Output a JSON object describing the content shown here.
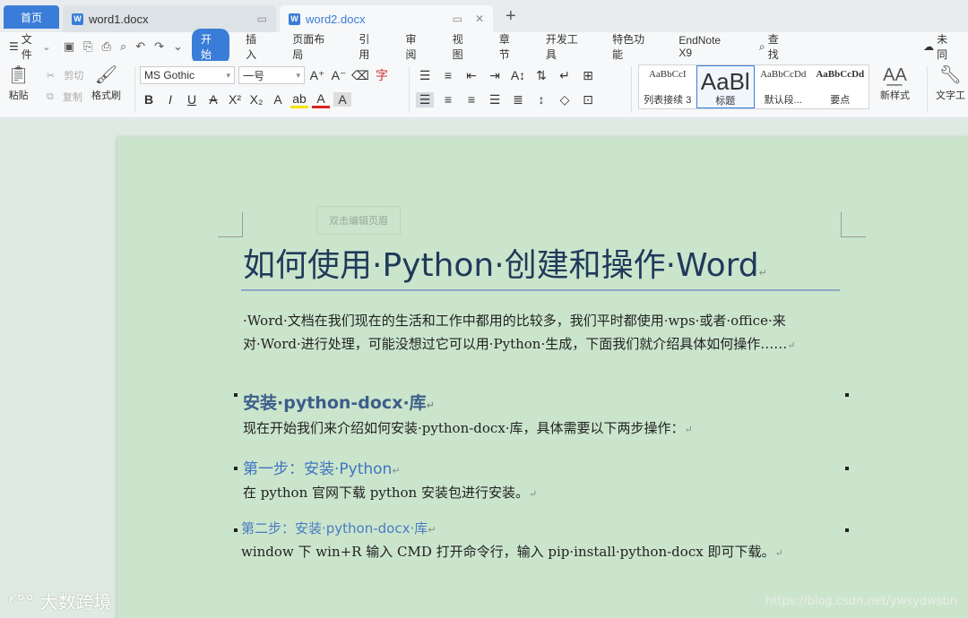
{
  "tabs": {
    "home": "首页",
    "doc1": "word1.docx",
    "doc2": "word2.docx",
    "new_tab": "+"
  },
  "menu": {
    "file": "文件",
    "items": [
      "开始",
      "插入",
      "页面布局",
      "引用",
      "审阅",
      "视图",
      "章节",
      "开发工具",
      "特色功能",
      "EndNote X9"
    ],
    "search": "查找",
    "sync": "未同"
  },
  "ribbon": {
    "paste": "粘贴",
    "cut": "剪切",
    "copy": "复制",
    "format_painter": "格式刷",
    "font_name": "MS Gothic",
    "font_size": "一号",
    "styles": [
      {
        "sample": "AaBbCcI",
        "label": "列表接续 3"
      },
      {
        "sample": "AaBl",
        "label": "标题"
      },
      {
        "sample": "AaBbCcDd",
        "label": "默认段..."
      },
      {
        "sample": "AaBbCcDd",
        "label": "要点"
      }
    ],
    "new_style": "新样式",
    "text_tool": "文字工"
  },
  "document": {
    "header_hint": "双击编辑页眉",
    "title": "如何使用·Python·创建和操作·Word",
    "intro_line1": "·Word·文档在我们现在的生活和工作中都用的比较多，我们平时都使用·wps·或者·office·来",
    "intro_line2": "对·Word·进行处理，可能没想过它可以用·Python·生成，下面我们就介绍具体如何操作……",
    "h_install": "安装·python-docx·库",
    "p_install": "现在开始我们来介绍如何安装·python-docx·库，具体需要以下两步操作：",
    "h_step1": "第一步：安装·Python",
    "p_step1": "在 python 官网下载 python 安装包进行安装。",
    "h_step2": "第二步：安装·python-docx·库",
    "p_step2": "window 下 win+R 输入 CMD 打开命令行，输入 pip·install·python-docx 即可下载。",
    "para_mark": "↵"
  },
  "watermarks": {
    "left": "大数跨境",
    "right": "https://blog.csdn.net/ywsydwsbn"
  }
}
